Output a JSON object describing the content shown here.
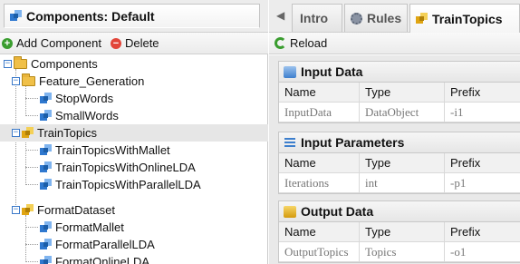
{
  "left": {
    "title": "Components: Default",
    "toolbar": {
      "add_label": "Add Component",
      "delete_label": "Delete"
    },
    "tree": [
      {
        "label": "Components",
        "icon": "folder-icon",
        "expander": "minus"
      },
      {
        "label": "Feature_Generation",
        "icon": "folder-icon",
        "expander": "minus"
      },
      {
        "label": "StopWords",
        "icon": "component-icon"
      },
      {
        "label": "SmallWords",
        "icon": "component-icon"
      },
      {
        "label": "TrainTopics",
        "icon": "component-gold-icon",
        "expander": "minus",
        "selected": true
      },
      {
        "label": "TrainTopicsWithMallet",
        "icon": "component-icon"
      },
      {
        "label": "TrainTopicsWithOnlineLDA",
        "icon": "component-icon"
      },
      {
        "label": "TrainTopicsWithParallelLDA",
        "icon": "component-icon"
      },
      {
        "label": "FormatDataset",
        "icon": "component-gold-icon",
        "expander": "minus"
      },
      {
        "label": "FormatMallet",
        "icon": "component-icon"
      },
      {
        "label": "FormatParallelLDA",
        "icon": "component-icon"
      },
      {
        "label": "FormatOnlineLDA",
        "icon": "component-icon"
      }
    ]
  },
  "right": {
    "tabs": [
      {
        "label": "Intro"
      },
      {
        "label": "Rules"
      },
      {
        "label": "TrainTopics",
        "active": true
      }
    ],
    "toolbar": {
      "reload_label": "Reload"
    },
    "columns": {
      "name": "Name",
      "type": "Type",
      "prefix": "Prefix"
    },
    "sections": [
      {
        "title": "Input Data",
        "icon": "input-data-icon",
        "rows": [
          {
            "name": "InputData",
            "type": "DataObject",
            "prefix": "-i1"
          }
        ]
      },
      {
        "title": "Input Parameters",
        "icon": "parameters-icon",
        "rows": [
          {
            "name": "Iterations",
            "type": "int",
            "prefix": "-p1"
          }
        ]
      },
      {
        "title": "Output Data",
        "icon": "output-data-icon",
        "rows": [
          {
            "name": "OutputTopics",
            "type": "Topics",
            "prefix": "-o1"
          }
        ]
      }
    ]
  },
  "colors": {
    "accent_blue": "#2f78cf",
    "component_gold": "#e0a512",
    "add_green": "#3a9d2f",
    "delete_red": "#e2463a",
    "selected_row": "#e6e6e6"
  }
}
